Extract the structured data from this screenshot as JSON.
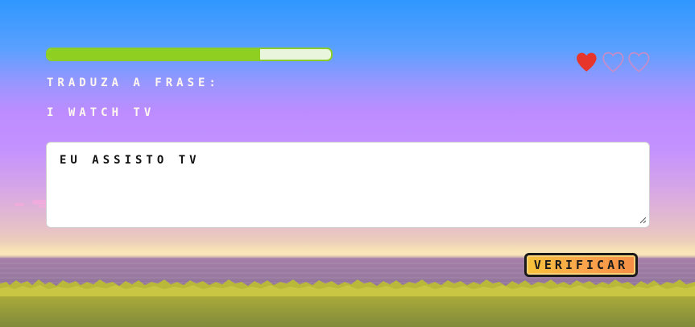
{
  "game": {
    "progress_fraction": 0.75,
    "lives_total": 3,
    "lives_remaining": 1,
    "instruction": "TRADUZA A FRASE:",
    "phrase": "I WATCH TV",
    "answer_value": "EU ASSISTO TV",
    "verify_label": "VERIFICAR"
  },
  "colors": {
    "progress_fill": "#8ecf22",
    "progress_track": "#e9f6dd",
    "heart_full": "#e8352c",
    "heart_empty_outline": "#c98cc7",
    "button_gradient_start": "#f7c23a",
    "button_gradient_end": "#f58f45"
  },
  "icons": {
    "heart": "heart-icon",
    "resize": "resize-grip-icon"
  }
}
